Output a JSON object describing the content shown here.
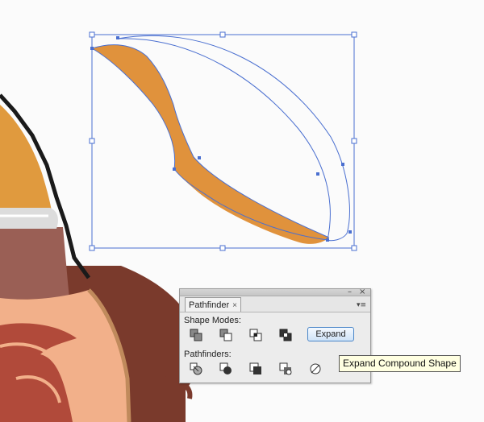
{
  "panel": {
    "tab_label": "Pathfinder",
    "tab_close_glyph": "×",
    "minimize_glyph": "–",
    "close_glyph": "×",
    "menu_glyph": "▾≡",
    "shape_modes_label": "Shape Modes:",
    "pathfinders_label": "Pathfinders:",
    "expand_label": "Expand",
    "shape_mode_icons": [
      "unite-icon",
      "minus-front-icon",
      "intersect-icon",
      "exclude-icon"
    ],
    "pathfinder_icons": [
      "divide-icon",
      "trim-icon",
      "merge-icon",
      "crop-icon",
      "outline-icon"
    ]
  },
  "tooltip": {
    "text": "Expand Compound Shape"
  },
  "colors": {
    "shape_fill": "#e0923c",
    "selection": "#4a6fd0",
    "hair": "#7a3a2c",
    "skin": "#f2b08a",
    "face_shadow": "#9a5f55",
    "horn": "#e09a3e",
    "hat_band": "#d9d9d9",
    "panel_bg": "#e6e6e6",
    "tooltip_bg": "#ffffe1"
  }
}
